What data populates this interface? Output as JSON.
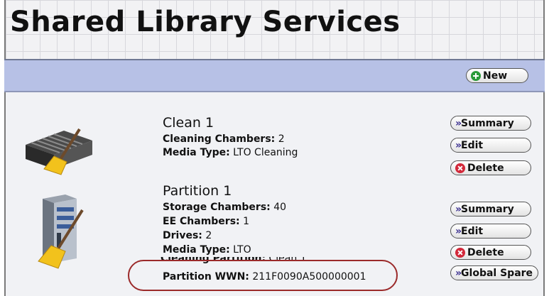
{
  "page_title": "Shared Library Services",
  "toolbar": {
    "new_label": "New"
  },
  "partitions": [
    {
      "name": "Clean 1",
      "fields": [
        {
          "label": "Cleaning Chambers:",
          "value": "2"
        },
        {
          "label": "Media Type:",
          "value": "LTO Cleaning"
        }
      ],
      "buttons": {
        "summary": "Summary",
        "edit": "Edit",
        "delete": "Delete"
      }
    },
    {
      "name": "Partition 1",
      "fields": [
        {
          "label": "Storage Chambers:",
          "value": "40"
        },
        {
          "label": "EE Chambers:",
          "value": "1"
        },
        {
          "label": "Drives:",
          "value": "2"
        },
        {
          "label": "Media Type:",
          "value": "LTO"
        },
        {
          "label": "Cleaning Partition:",
          "value": "Clean 1"
        },
        {
          "label": "Partition WWN:",
          "value": "211F0090A500000001"
        }
      ],
      "buttons": {
        "summary": "Summary",
        "edit": "Edit",
        "delete": "Delete",
        "global_spare": "Global Spare"
      }
    }
  ],
  "icons": {
    "chevron": "»",
    "clean_partition": "tape-library-broom-icon",
    "storage_partition": "library-tower-broom-icon"
  },
  "colors": {
    "toolbar": "#b7c1e6",
    "highlight": "#9b2a2a",
    "add": "#2a9a3a",
    "delete": "#d2283a"
  }
}
